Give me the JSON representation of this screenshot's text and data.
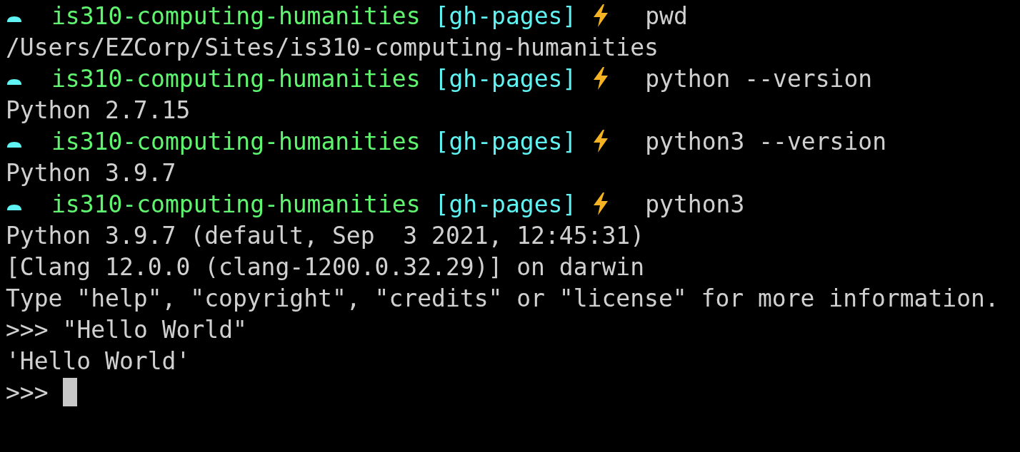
{
  "lines": [
    {
      "kind": "prompt",
      "directory": "is310-computing-humanities",
      "branch": "[gh-pages]",
      "command": "pwd"
    },
    {
      "kind": "output",
      "text": "/Users/EZCorp/Sites/is310-computing-humanities"
    },
    {
      "kind": "prompt",
      "directory": "is310-computing-humanities",
      "branch": "[gh-pages]",
      "command": "python --version"
    },
    {
      "kind": "output",
      "text": "Python 2.7.15"
    },
    {
      "kind": "prompt",
      "directory": "is310-computing-humanities",
      "branch": "[gh-pages]",
      "command": "python3 --version"
    },
    {
      "kind": "output",
      "text": "Python 3.9.7"
    },
    {
      "kind": "prompt",
      "directory": "is310-computing-humanities",
      "branch": "[gh-pages]",
      "command": "python3"
    },
    {
      "kind": "output",
      "text": "Python 3.9.7 (default, Sep  3 2021, 12:45:31)"
    },
    {
      "kind": "output",
      "text": "[Clang 12.0.0 (clang-1200.0.32.29)] on darwin"
    },
    {
      "kind": "output",
      "text": "Type \"help\", \"copyright\", \"credits\" or \"license\" for more information."
    },
    {
      "kind": "repl",
      "prompt": ">>>",
      "text": "\"Hello World\""
    },
    {
      "kind": "output",
      "text": "'Hello World'"
    },
    {
      "kind": "repl",
      "prompt": ">>>",
      "cursor": true
    }
  ]
}
